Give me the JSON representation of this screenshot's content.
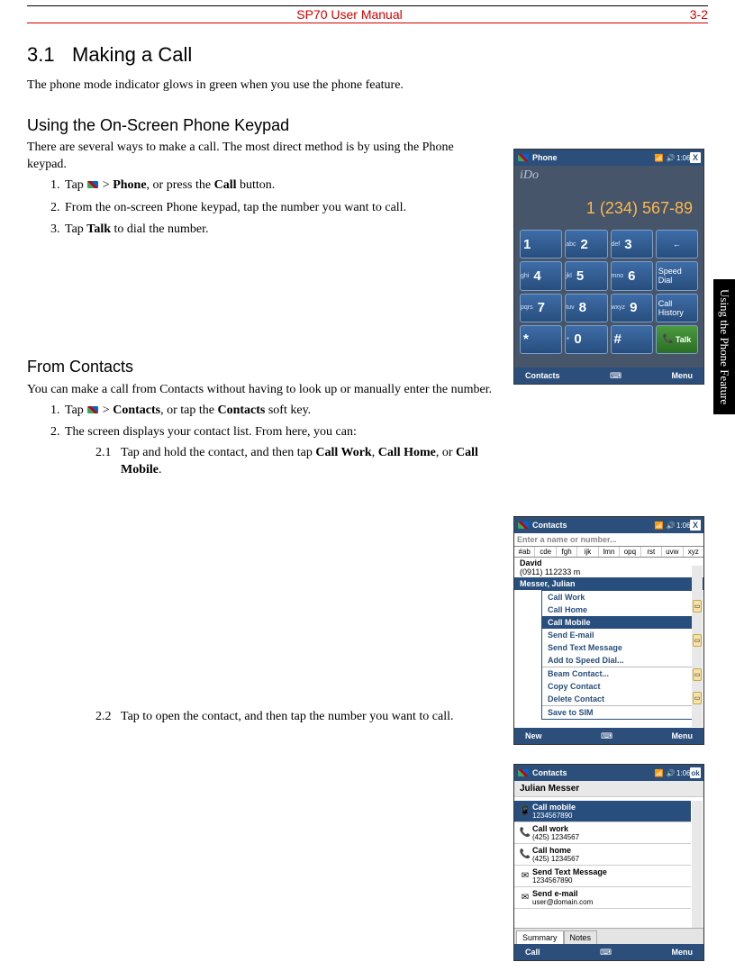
{
  "header": {
    "title": "SP70 User Manual",
    "page": "3-2"
  },
  "sidetab": "Using the Phone Feature",
  "sec": {
    "num": "3.1",
    "title": "Making a Call"
  },
  "intro": "The phone mode indicator glows in green when you use the phone feature.",
  "sub1": {
    "title": "Using the On-Screen Phone Keypad",
    "lead": "There are several ways to make a call. The most direct method is by using the Phone keypad.",
    "step1a": "Tap ",
    "step1b": " > ",
    "step1_bold1": "Phone",
    "step1c": ", or press the ",
    "step1_bold2": "Call",
    "step1d": " button.",
    "step2": "From the on-screen Phone keypad, tap the number you want to call.",
    "step3a": "Tap ",
    "step3_bold": "Talk",
    "step3b": " to dial the number."
  },
  "sub2": {
    "title": "From Contacts",
    "lead": "You can make a call from Contacts without having to look up or manually enter the number.",
    "step1a": "Tap ",
    "step1b": " > ",
    "step1_bold1": "Contacts",
    "step1c": ", or tap the ",
    "step1_bold2": "Contacts",
    "step1d": " soft key.",
    "step2": "The screen displays your contact list. From here, you can:",
    "s21n": "2.1",
    "s21a": "Tap and hold the contact, and then tap ",
    "s21_b1": "Call Work",
    "s21b": ", ",
    "s21_b2": "Call Home",
    "s21c": ", or ",
    "s21_b3": "Call Mobile",
    "s21d": ".",
    "s22n": "2.2",
    "s22": "Tap to open the contact, and then tap the number you want to call."
  },
  "fig1": {
    "title": "Phone",
    "time": "1:06",
    "close": "X",
    "carrier": "iDo",
    "number": "1 (234) 567-89",
    "keys": [
      {
        "d": "1"
      },
      {
        "s": "abc",
        "d": "2"
      },
      {
        "s": "def",
        "d": "3"
      },
      {
        "w": "←"
      },
      {
        "s": "ghi",
        "d": "4"
      },
      {
        "s": "jkl",
        "d": "5"
      },
      {
        "s": "mno",
        "d": "6"
      },
      {
        "w": "Speed Dial"
      },
      {
        "s": "pqrs",
        "d": "7"
      },
      {
        "s": "tuv",
        "d": "8"
      },
      {
        "s": "wxyz",
        "d": "9"
      },
      {
        "w": "Call History"
      },
      {
        "d": "*"
      },
      {
        "s": "+",
        "d": "0"
      },
      {
        "d": "#"
      },
      {
        "talk": "Talk"
      }
    ],
    "soft_left": "Contacts",
    "soft_right": "Menu"
  },
  "fig2": {
    "title": "Contacts",
    "time": "1:06",
    "close": "X",
    "search": "Enter a name or number...",
    "alpha": [
      "#ab",
      "cde",
      "fgh",
      "ijk",
      "lmn",
      "opq",
      "rst",
      "uvw",
      "xyz"
    ],
    "row1_name": "David",
    "row1_num": "(0911) 112233   m",
    "row_sel": "Messer, Julian",
    "menu": [
      {
        "t": "Call Work"
      },
      {
        "t": "Call Home"
      },
      {
        "t": "Call Mobile",
        "sel": true
      },
      {
        "t": "Send E-mail"
      },
      {
        "t": "Send Text Message"
      },
      {
        "t": "Add to Speed Dial..."
      },
      {
        "sep": true
      },
      {
        "t": "Beam Contact..."
      },
      {
        "t": "Copy Contact"
      },
      {
        "t": "Delete Contact"
      },
      {
        "sep": true
      },
      {
        "t": "Save to SIM"
      }
    ],
    "soft_left": "New",
    "soft_right": "Menu"
  },
  "fig3": {
    "title": "Contacts",
    "time": "1:06",
    "ok": "ok",
    "name": "Julian Messer",
    "items": [
      {
        "sel": true,
        "icn": "📱",
        "lbl": "Call mobile",
        "val": "1234567890"
      },
      {
        "icn": "📞",
        "lbl": "Call work",
        "val": "(425) 1234567"
      },
      {
        "icn": "📞",
        "lbl": "Call home",
        "val": "(425) 1234567"
      },
      {
        "icn": "✉",
        "lbl": "Send Text Message",
        "val": "1234567890"
      },
      {
        "icn": "✉",
        "lbl": "Send e-mail",
        "val": "user@domain.com"
      }
    ],
    "tabs": [
      "Summary",
      "Notes"
    ],
    "soft_left": "Call",
    "soft_right": "Menu"
  }
}
